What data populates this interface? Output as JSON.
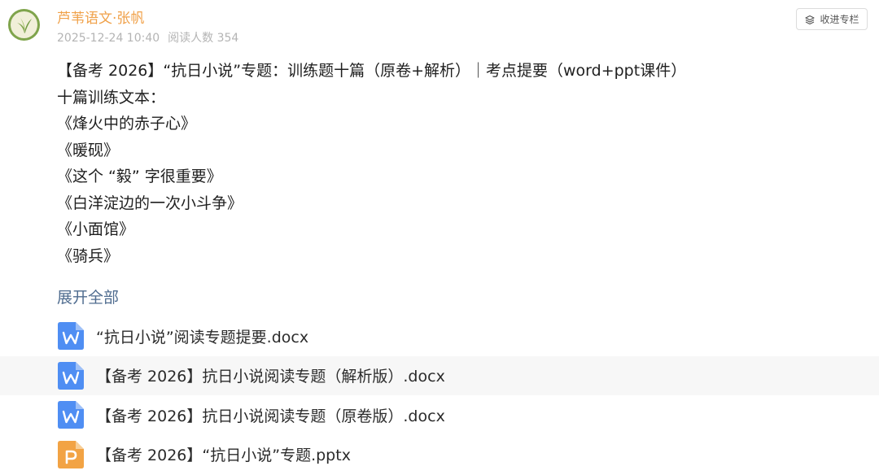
{
  "header": {
    "author": "芦苇语文·张帆",
    "date": "2025-12-24 10:40",
    "reads": "阅读人数 354",
    "collect_button": "收进专栏",
    "avatar_icon": "reed-leaf-icon",
    "collect_icon": "collect-stack-icon"
  },
  "article": {
    "lines": [
      "【备考 2026】“抗日小说”专题：训练题十篇（原卷+解析）｜考点提要（word+ppt课件）",
      "十篇训练文本：",
      "《烽火中的赤子心》",
      "《暖砚》",
      "《这个 “毅” 字很重要》",
      "《白洋淀边的一次小斗争》",
      "《小面馆》",
      "《骑兵》"
    ],
    "expand_label": "展开全部"
  },
  "attachments": [
    {
      "name": "“抗日小说”阅读专题提要.docx",
      "type": "word",
      "icon": "word-doc-icon",
      "letter": "W"
    },
    {
      "name": "【备考 2026】抗日小说阅读专题（解析版）.docx",
      "type": "word",
      "icon": "word-doc-icon",
      "letter": "W"
    },
    {
      "name": "【备考 2026】抗日小说阅读专题（原卷版）.docx",
      "type": "word",
      "icon": "word-doc-icon",
      "letter": "W"
    },
    {
      "name": "【备考 2026】“抗日小说”专题.pptx",
      "type": "ppt",
      "icon": "ppt-doc-icon",
      "letter": "P"
    }
  ],
  "colors": {
    "author": "#f0a149",
    "meta": "#b4b4b4",
    "link": "#4f6c8f",
    "word": "#4f8ef3",
    "ppt": "#f2a344",
    "row_highlight": "#f7f7f7"
  }
}
